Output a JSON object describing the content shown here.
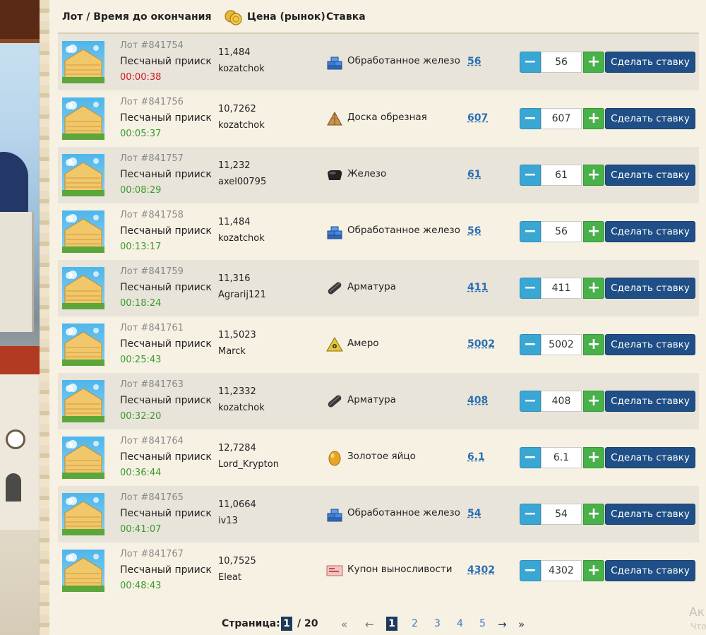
{
  "header": {
    "col_lot": "Лот / Время до окончания",
    "col_price": "Цена (рынок)",
    "col_bid": "Ставка"
  },
  "bid_button_label": "Сделать ставку",
  "lots": [
    {
      "lot": "Лот #841754",
      "name": "Песчаный прииск",
      "time": "00:00:38",
      "urgent": true,
      "price": "11,484",
      "seller": "kozatchok",
      "resource": "Обработанное железо",
      "icon": "processed-iron-icon",
      "bid": "56",
      "qty": "56"
    },
    {
      "lot": "Лот #841756",
      "name": "Песчаный прииск",
      "time": "00:05:37",
      "urgent": false,
      "price": "10,7262",
      "seller": "kozatchok",
      "resource": "Доска обрезная",
      "icon": "board-icon",
      "bid": "607",
      "qty": "607"
    },
    {
      "lot": "Лот #841757",
      "name": "Песчаный прииск",
      "time": "00:08:29",
      "urgent": false,
      "price": "11,232",
      "seller": "axel00795",
      "resource": "Железо",
      "icon": "iron-icon",
      "bid": "61",
      "qty": "61"
    },
    {
      "lot": "Лот #841758",
      "name": "Песчаный прииск",
      "time": "00:13:17",
      "urgent": false,
      "price": "11,484",
      "seller": "kozatchok",
      "resource": "Обработанное железо",
      "icon": "processed-iron-icon",
      "bid": "56",
      "qty": "56"
    },
    {
      "lot": "Лот #841759",
      "name": "Песчаный прииск",
      "time": "00:18:24",
      "urgent": false,
      "price": "11,316",
      "seller": "Agrarij121",
      "resource": "Арматура",
      "icon": "rebar-icon",
      "bid": "411",
      "qty": "411"
    },
    {
      "lot": "Лот #841761",
      "name": "Песчаный прииск",
      "time": "00:25:43",
      "urgent": false,
      "price": "11,5023",
      "seller": "Marck",
      "resource": "Амеро",
      "icon": "amero-icon",
      "bid": "5002",
      "qty": "5002"
    },
    {
      "lot": "Лот #841763",
      "name": "Песчаный прииск",
      "time": "00:32:20",
      "urgent": false,
      "price": "11,2332",
      "seller": "kozatchok",
      "resource": "Арматура",
      "icon": "rebar-icon",
      "bid": "408",
      "qty": "408"
    },
    {
      "lot": "Лот #841764",
      "name": "Песчаный прииск",
      "time": "00:36:44",
      "urgent": false,
      "price": "12,7284",
      "seller": "Lord_Krypton",
      "resource": "Золотое яйцо",
      "icon": "golden-egg-icon",
      "bid": "6.1",
      "qty": "6.1"
    },
    {
      "lot": "Лот #841765",
      "name": "Песчаный прииск",
      "time": "00:41:07",
      "urgent": false,
      "price": "11,0664",
      "seller": "iv13",
      "resource": "Обработанное железо",
      "icon": "processed-iron-icon",
      "bid": "54",
      "qty": "54"
    },
    {
      "lot": "Лот #841767",
      "name": "Песчаный прииск",
      "time": "00:48:43",
      "urgent": false,
      "price": "10,7525",
      "seller": "Eleat",
      "resource": "Купон выносливости",
      "icon": "stamina-coupon-icon",
      "bid": "4302",
      "qty": "4302"
    }
  ],
  "pagination": {
    "label": "Страница:",
    "current": "1",
    "total": "/ 20",
    "pages": [
      "1",
      "2",
      "3",
      "4",
      "5"
    ],
    "first": "«",
    "prev": "←",
    "next": "→",
    "last": "»"
  },
  "watermark": {
    "line1": "Ак",
    "line2": "Что"
  },
  "colors": {
    "time_ok": "#3a9a2e",
    "time_urgent": "#d0161e",
    "bid_button": "#1f4f86",
    "minus": "#3aa6d4",
    "plus": "#48b14a",
    "bid_link": "#2a6fb1"
  }
}
